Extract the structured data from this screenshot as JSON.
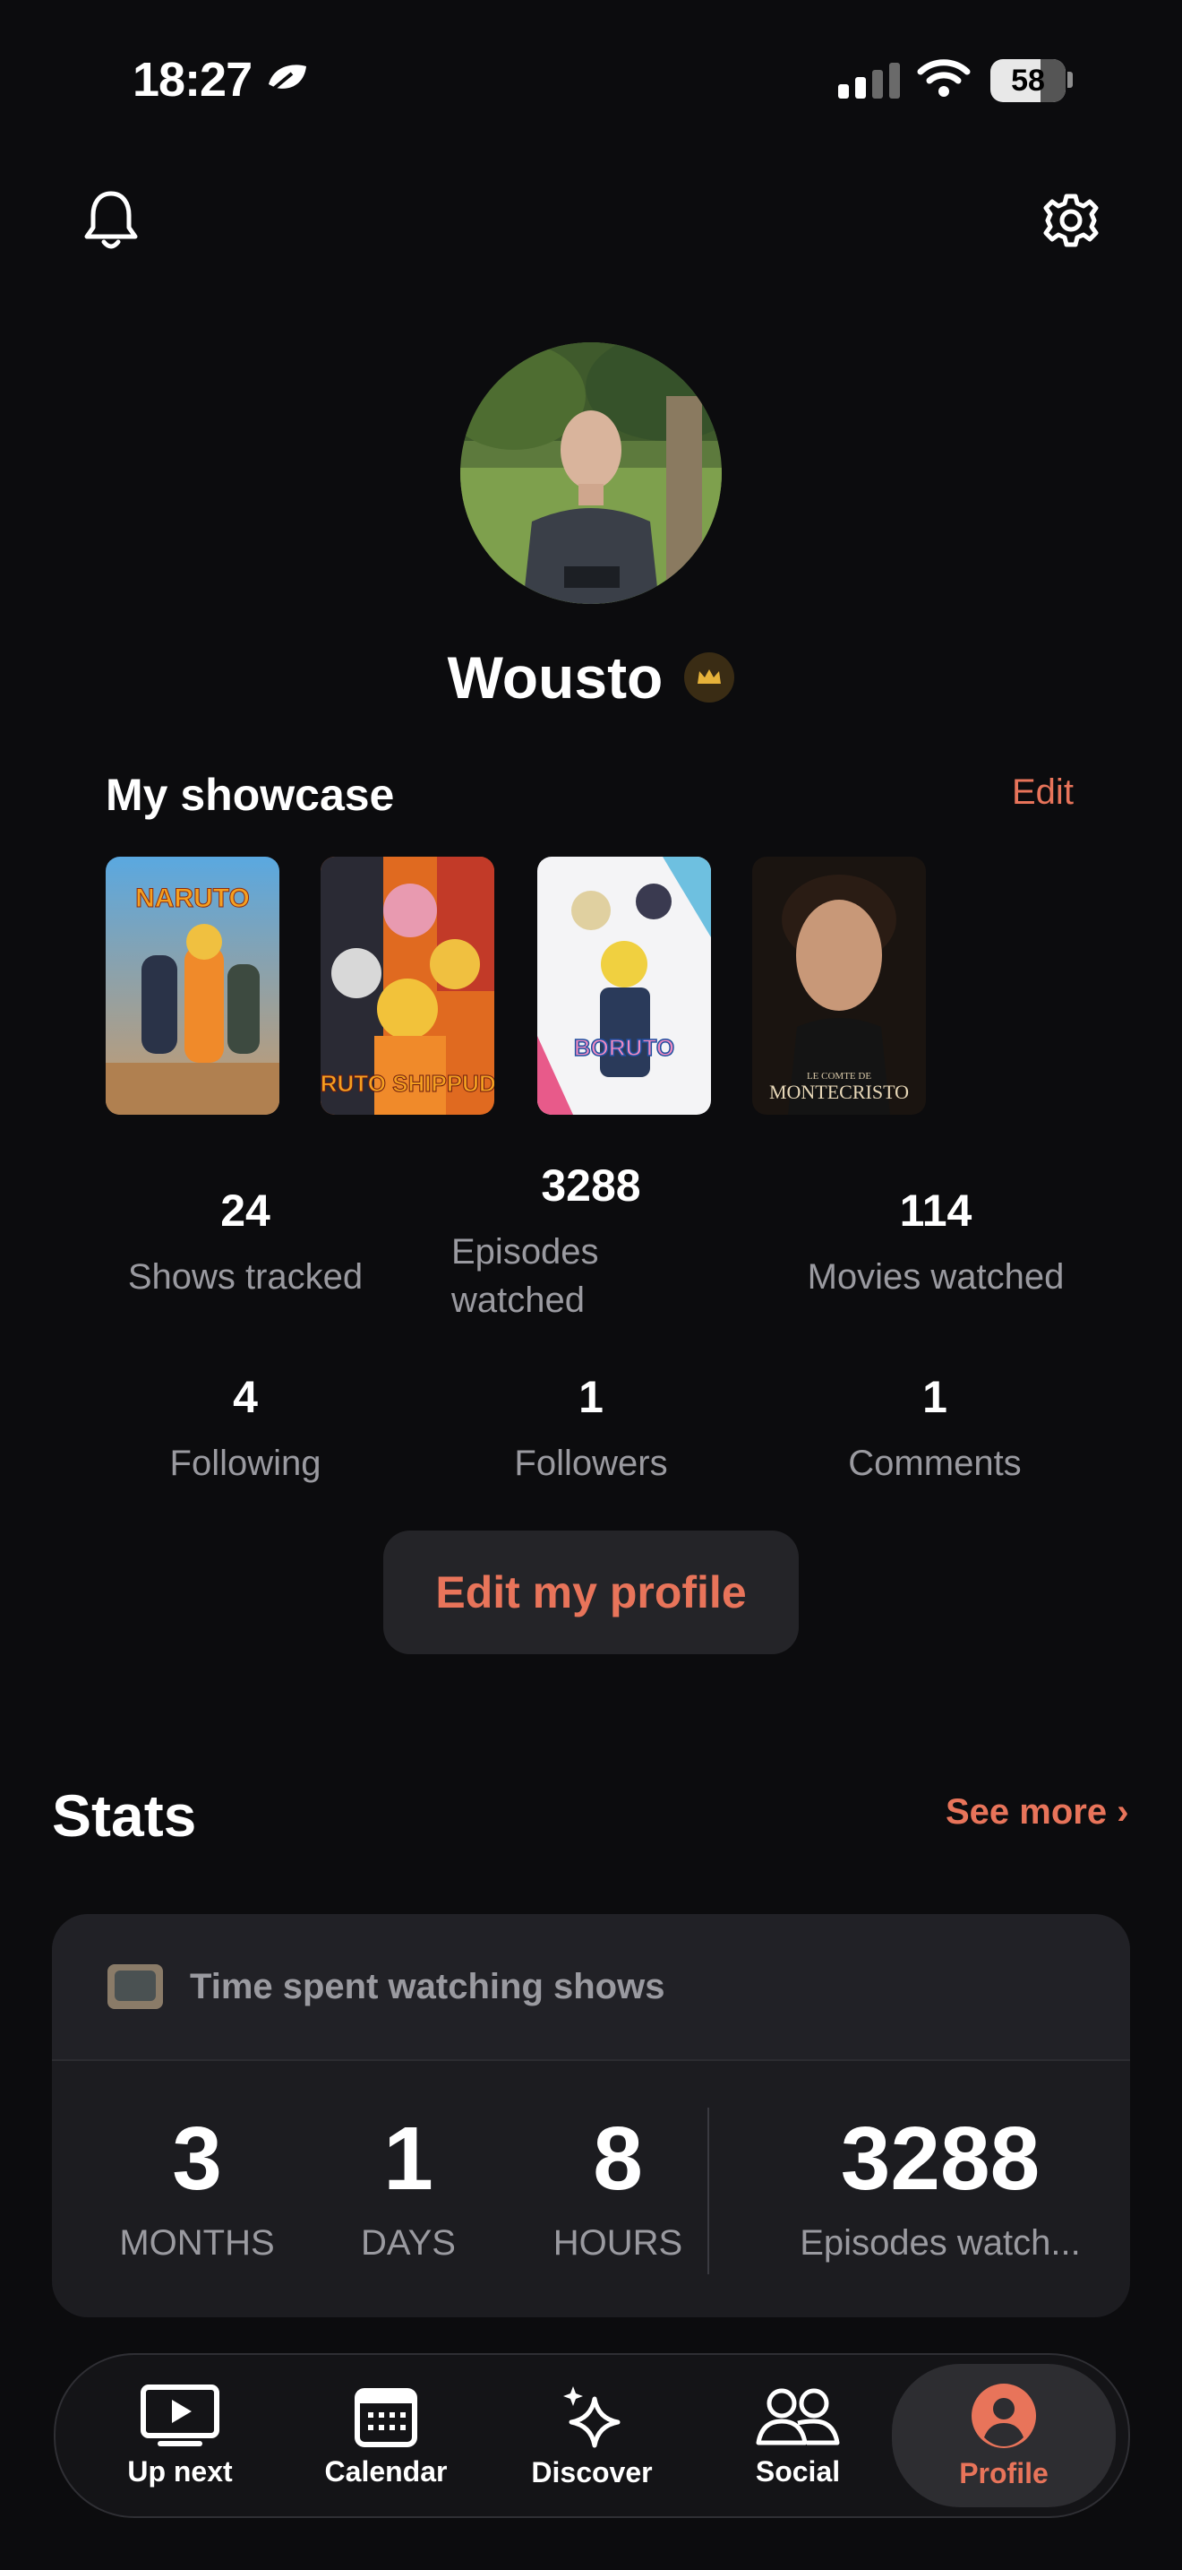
{
  "status_bar": {
    "time": "18:27",
    "battery": "58"
  },
  "profile": {
    "username": "Wousto"
  },
  "showcase": {
    "title": "My showcase",
    "edit_label": "Edit",
    "posters": [
      {
        "title": "NARUTO"
      },
      {
        "title": "NARUTO SHIPPUDEN"
      },
      {
        "title": "BORUTO"
      },
      {
        "title": "MONTECRISTO",
        "subtitle": "LE COMTE DE"
      }
    ]
  },
  "stats_grid": {
    "shows_tracked": {
      "value": "24",
      "label": "Shows tracked"
    },
    "episodes_watched": {
      "value": "3288",
      "label": "Episodes watched"
    },
    "movies_watched": {
      "value": "114",
      "label": "Movies watched"
    },
    "following": {
      "value": "4",
      "label": "Following"
    },
    "followers": {
      "value": "1",
      "label": "Followers"
    },
    "comments": {
      "value": "1",
      "label": "Comments"
    }
  },
  "edit_profile_label": "Edit my profile",
  "stats_section": {
    "title": "Stats",
    "see_more": "See more ›",
    "card_title": "Time spent watching shows",
    "months": {
      "value": "3",
      "label": "MONTHS"
    },
    "days": {
      "value": "1",
      "label": "DAYS"
    },
    "hours": {
      "value": "8",
      "label": "HOURS"
    },
    "episodes": {
      "value": "3288",
      "label": "Episodes watch..."
    }
  },
  "tabs": [
    {
      "label": "Up next",
      "icon": "play-icon"
    },
    {
      "label": "Calendar",
      "icon": "calendar-icon"
    },
    {
      "label": "Discover",
      "icon": "sparkle-icon"
    },
    {
      "label": "Social",
      "icon": "people-icon"
    },
    {
      "label": "Profile",
      "icon": "profile-icon"
    }
  ],
  "colors": {
    "accent": "#e8745a",
    "background": "#0c0c0e",
    "card": "#1c1c20"
  }
}
